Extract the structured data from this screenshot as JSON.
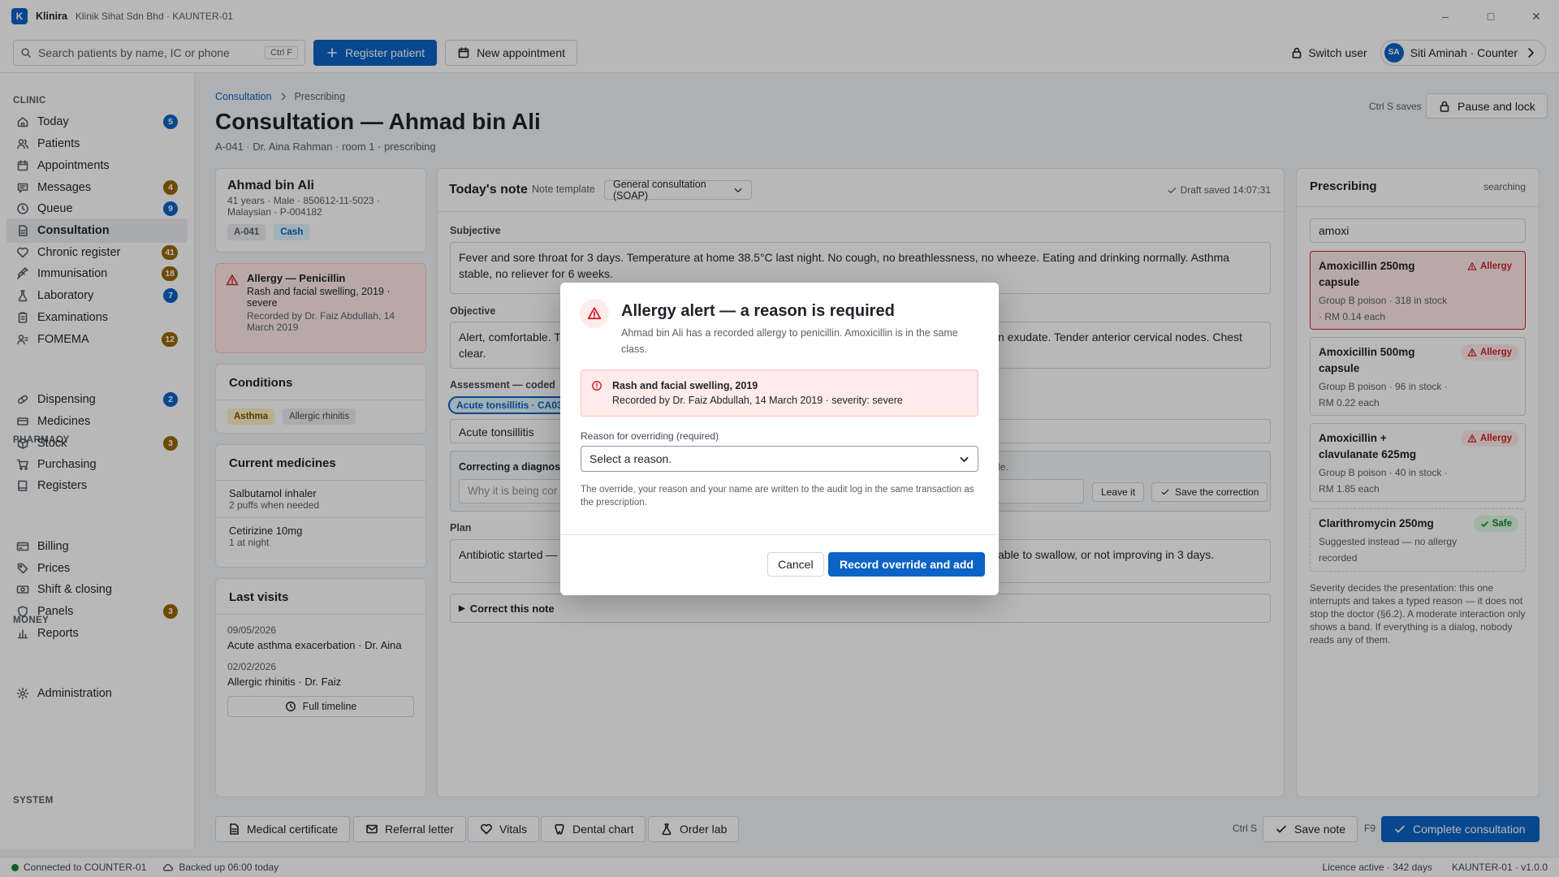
{
  "titlebar": {
    "app": "Klinira",
    "subtitle": "Klinik Sihat Sdn Bhd · KAUNTER-01",
    "logo": "K"
  },
  "toolbar": {
    "search_placeholder": "Search patients by name, IC or phone",
    "search_shortcut": "Ctrl F",
    "register": "Register patient",
    "new_appointment": "New appointment",
    "switch_user": "Switch user",
    "user_initials": "SA",
    "user": "Siti Aminah · Counter"
  },
  "sidebar": {
    "sections": {
      "clinic": "CLINIC",
      "pharmacy": "PHARMACY",
      "money": "MONEY",
      "system": "SYSTEM"
    },
    "clinic": [
      {
        "label": "Today",
        "badge": "5",
        "badge_color": "blue",
        "icon": "home-icon"
      },
      {
        "label": "Patients",
        "badge": "",
        "icon": "users-icon"
      },
      {
        "label": "Appointments",
        "badge": "",
        "icon": "calendar-icon"
      },
      {
        "label": "Messages",
        "badge": "4",
        "badge_color": "orange",
        "icon": "message-icon"
      },
      {
        "label": "Queue",
        "badge": "9",
        "badge_color": "blue",
        "icon": "clock-icon"
      },
      {
        "label": "Consultation",
        "badge": "",
        "icon": "document-icon",
        "active": true
      },
      {
        "label": "Chronic register",
        "badge": "41",
        "badge_color": "orange",
        "icon": "heart-icon"
      },
      {
        "label": "Immunisation",
        "badge": "18",
        "badge_color": "orange",
        "icon": "syringe-icon"
      },
      {
        "label": "Laboratory",
        "badge": "7",
        "badge_color": "blue",
        "icon": "flask-icon"
      },
      {
        "label": "Examinations",
        "badge": "",
        "icon": "clipboard-icon"
      },
      {
        "label": "FOMEMA",
        "badge": "12",
        "badge_color": "orange",
        "icon": "id-icon"
      }
    ],
    "pharmacy": [
      {
        "label": "Dispensing",
        "badge": "2",
        "badge_color": "blue",
        "icon": "pill-icon"
      },
      {
        "label": "Medicines",
        "badge": "",
        "icon": "capsule-icon"
      },
      {
        "label": "Stock",
        "badge": "3",
        "badge_color": "orange",
        "icon": "box-icon"
      },
      {
        "label": "Purchasing",
        "badge": "",
        "icon": "cart-icon"
      },
      {
        "label": "Registers",
        "badge": "",
        "icon": "book-icon"
      }
    ],
    "money": [
      {
        "label": "Billing",
        "badge": "",
        "icon": "card-icon"
      },
      {
        "label": "Prices",
        "badge": "",
        "icon": "tag-icon"
      },
      {
        "label": "Shift & closing",
        "badge": "",
        "icon": "cash-icon"
      },
      {
        "label": "Panels",
        "badge": "3",
        "badge_color": "orange",
        "icon": "shield-icon"
      },
      {
        "label": "Reports",
        "badge": "",
        "icon": "bar-chart-icon"
      }
    ],
    "system": [
      {
        "label": "Administration",
        "badge": "",
        "icon": "gear-icon"
      }
    ]
  },
  "breadcrumb": {
    "parent": "Consultation",
    "current": "Prescribing"
  },
  "page": {
    "title": "Consultation — Ahmad bin Ali",
    "subtitle": "A-041 · Dr. Aina Rahman · room 1 · prescribing",
    "ctrl_s": "Ctrl S saves",
    "pause_lock": "Pause and lock"
  },
  "patient": {
    "name": "Ahmad bin Ali",
    "line1": "41 years · Male · 850612-11-5023 ·",
    "line2": "Malaysian · P-004182",
    "queue_chip": "A-041",
    "payment_chip": "Cash"
  },
  "allergy_card": {
    "title": "Allergy — Penicillin",
    "reaction": "Rash and facial swelling, 2019 ·",
    "severity": "severe",
    "recorded1": "Recorded by Dr. Faiz Abdullah, 14",
    "recorded2": "March 2019"
  },
  "conditions": {
    "title": "Conditions",
    "items": [
      "Asthma",
      "Allergic rhinitis"
    ]
  },
  "medicines": {
    "title": "Current medicines",
    "items": [
      {
        "name": "Salbutamol inhaler",
        "dose": "2 puffs when needed"
      },
      {
        "name": "Cetirizine 10mg",
        "dose": "1 at night"
      }
    ]
  },
  "visits": {
    "title": "Last visits",
    "items": [
      {
        "date": "09/05/2026",
        "desc": "Acute asthma exacerbation · Dr. Aina"
      },
      {
        "date": "02/02/2026",
        "desc": "Allergic rhinitis · Dr. Faiz"
      }
    ],
    "timeline": "Full timeline"
  },
  "note": {
    "title": "Today's note",
    "template_label": "Note template",
    "template_value": "General consultation (SOAP)",
    "draft": "Draft saved 14:07:31",
    "subjective_label": "Subjective",
    "subjective": "Fever and sore throat for 3 days. Temperature at home 38.5°C last night. No cough, no breathlessness, no wheeze. Eating and drinking normally. Asthma stable, no reliever for 6 weeks.",
    "objective_label": "Objective",
    "objective_left": "Alert, comfortable. T",
    "objective_right": "n exudate. Tender anterior cervical nodes. Chest",
    "objective_line2": "clear.",
    "assessment_label": "Assessment — coded",
    "assessment_chip": "Acute tonsillitis · CA03.",
    "assessment_text": "Acute tonsillitis",
    "correcting_label": "Correcting a diagnosis",
    "correcting_tail": "le.",
    "correcting_placeholder": "Why it is being cor",
    "leave_it": "Leave it",
    "save_correction": "Save the correction",
    "plan_label": "Plan",
    "plan_left": "Antibiotic started —",
    "plan_right": "able to swallow, or not improving in 3 days.",
    "correct_note": "Correct this note"
  },
  "prescribing": {
    "title": "Prescribing",
    "status": "searching",
    "query": "amoxi",
    "results": [
      {
        "name": "Amoxicillin 250mg capsule",
        "meta1": "Group B poison · 318 in stock",
        "meta2": "· RM 0.14 each",
        "tag": "Allergy",
        "kind": "allergy",
        "selected": true
      },
      {
        "name": "Amoxicillin 500mg capsule",
        "meta1": "Group B poison · 96 in stock ·",
        "meta2": "RM 0.22 each",
        "tag": "Allergy",
        "kind": "allergy"
      },
      {
        "name": "Amoxicillin + clavulanate 625mg",
        "meta1": "Group B poison · 40 in stock ·",
        "meta2": "RM 1.85 each",
        "tag": "Allergy",
        "kind": "allergy"
      },
      {
        "name": "Clarithromycin 250mg",
        "meta1": "Suggested instead — no allergy",
        "meta2": "recorded",
        "tag": "Safe",
        "kind": "safe"
      }
    ],
    "note": "Severity decides the presentation: this one interrupts and takes a typed reason — it does not stop the doctor (§6.2). A moderate interaction only shows a band. If everything is a dialog, nobody reads any of them."
  },
  "bottom": {
    "medical_certificate": "Medical certificate",
    "referral": "Referral letter",
    "vitals": "Vitals",
    "dental": "Dental chart",
    "order_lab": "Order lab",
    "ctrl_s": "Ctrl S",
    "save_note": "Save note",
    "f9": "F9",
    "complete": "Complete consultation"
  },
  "status": {
    "connected": "Connected to COUNTER-01",
    "backup": "Backed up 06:00 today",
    "licence": "Licence active · 342 days",
    "version": "KAUNTER-01 · v1.0.0"
  },
  "dialog": {
    "title": "Allergy alert — a reason is required",
    "body": "Ahmad bin Ali has a recorded allergy to penicillin. Amoxicillin is in the same class.",
    "alert_title": "Rash and facial swelling, 2019",
    "alert_detail": "Recorded by Dr. Faiz Abdullah, 14 March 2019 · severity: severe",
    "reason_label": "Reason for overriding (required)",
    "reason_placeholder": "Select a reason.",
    "audit": "The override, your reason and your name are written to the audit log in the same transaction as the prescription.",
    "cancel": "Cancel",
    "confirm": "Record override and add"
  },
  "colors": {
    "accent": "#0b63c5",
    "danger": "#cf222e",
    "danger_bg": "#ffebe9",
    "success": "#1a7f37",
    "warning_badge": "#9a6700"
  }
}
